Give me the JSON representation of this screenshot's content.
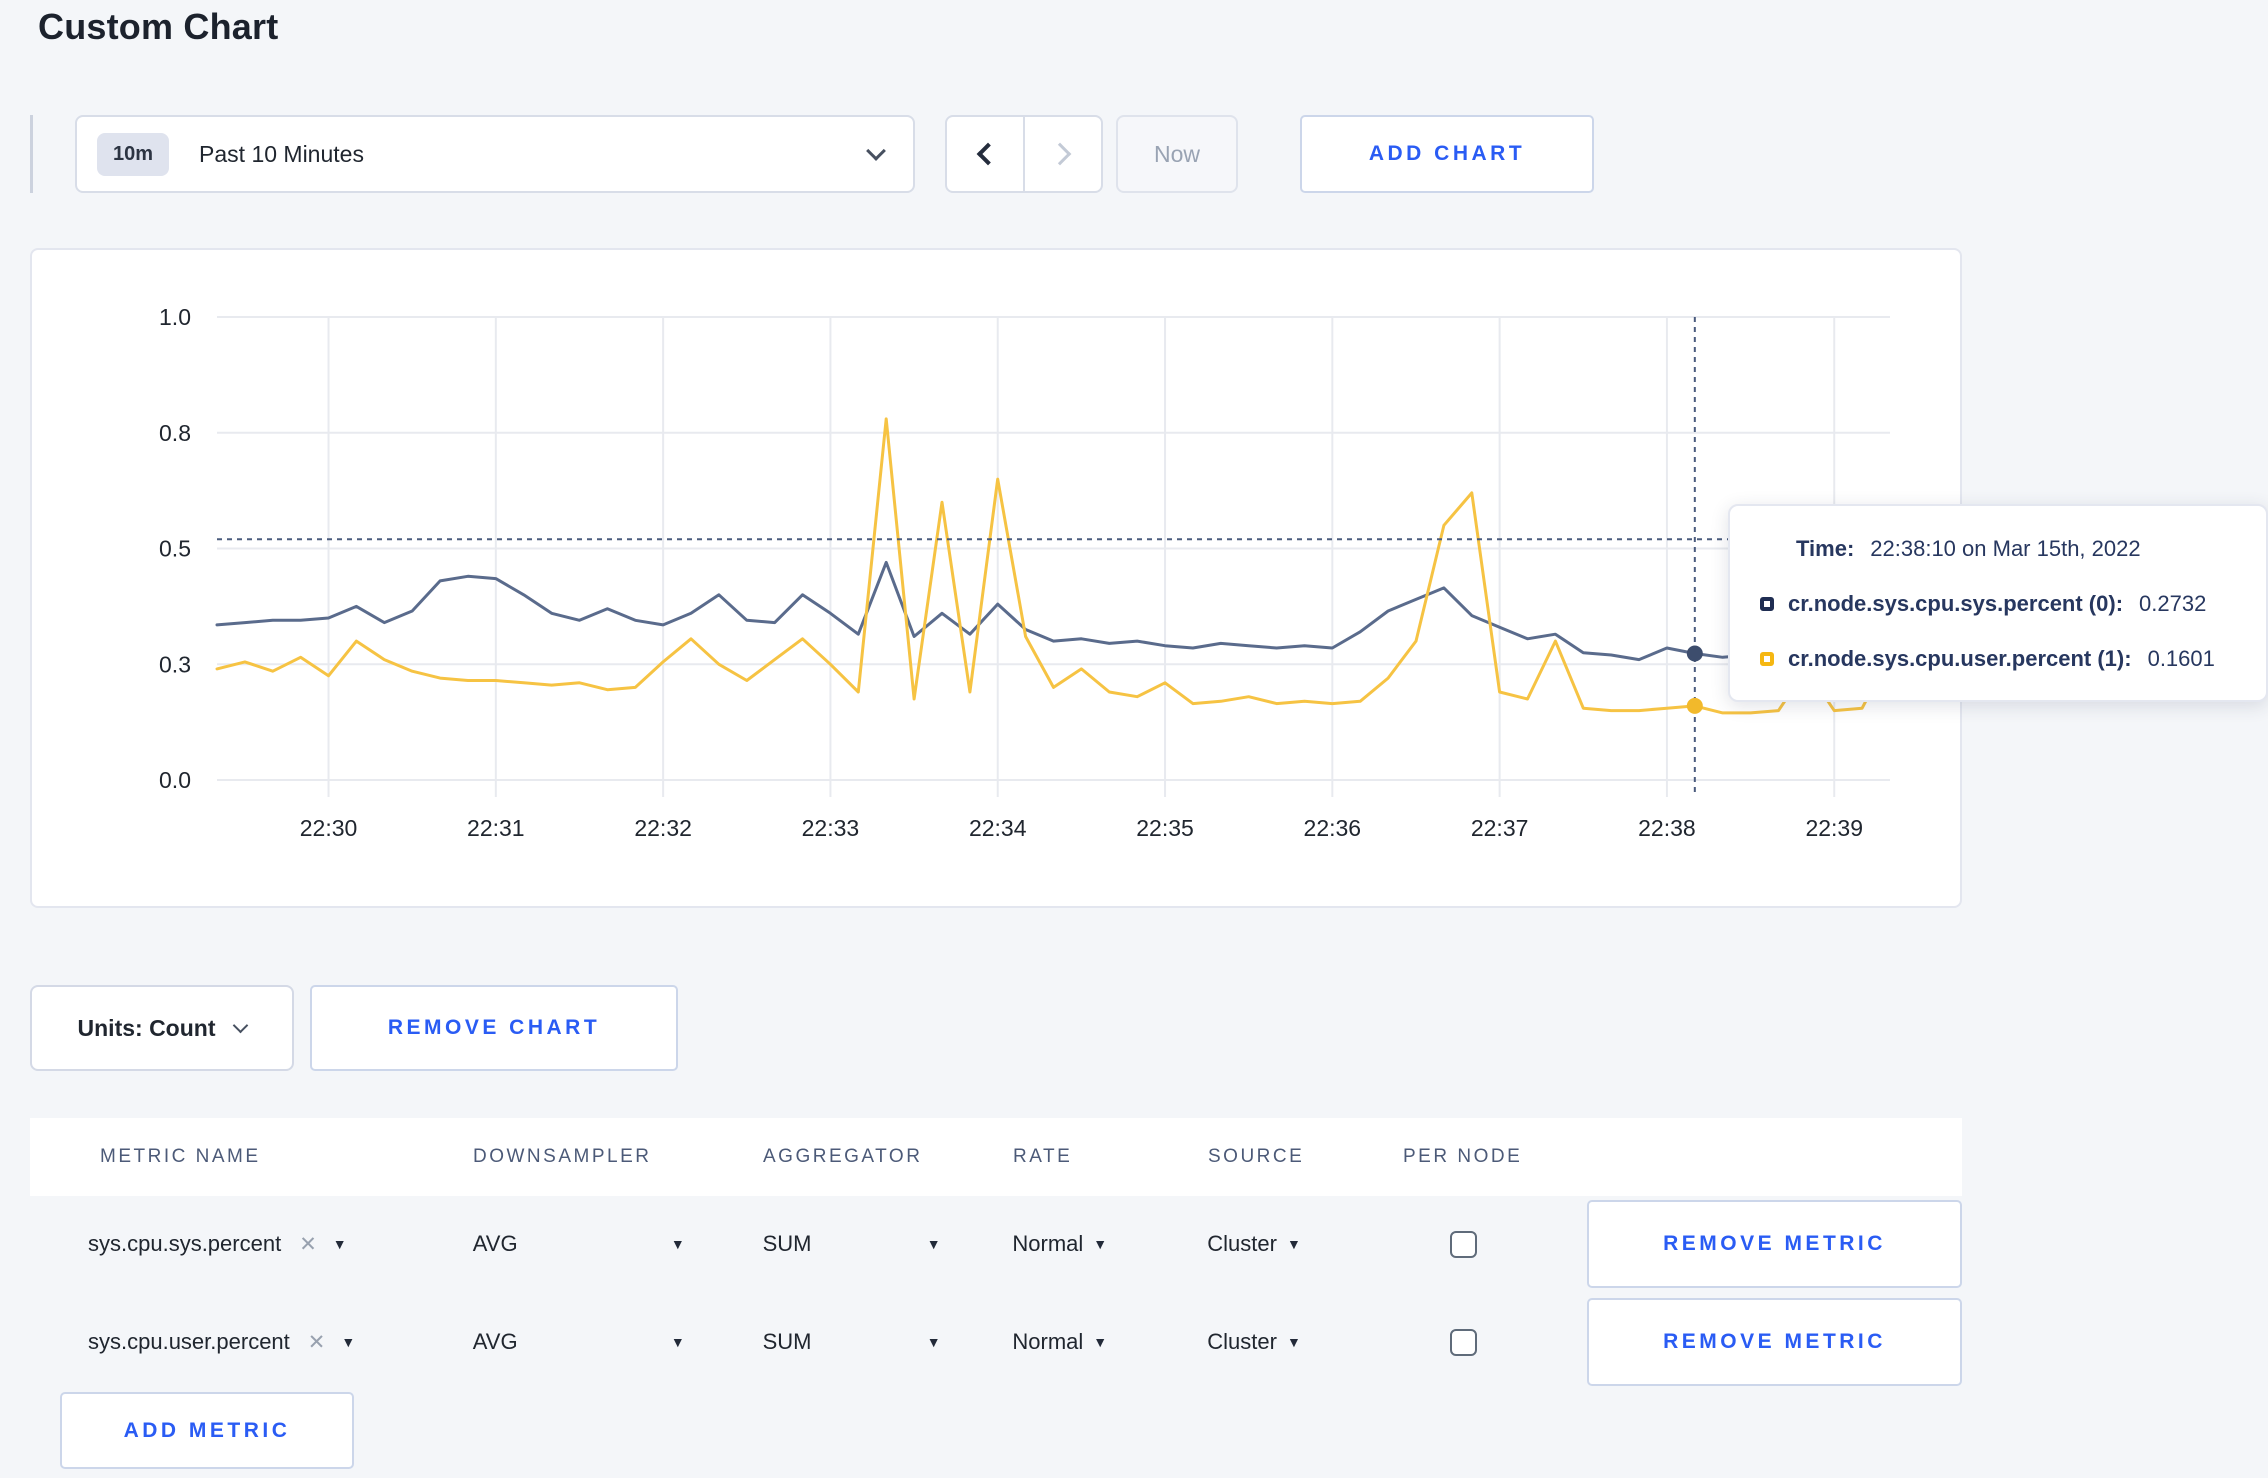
{
  "page": {
    "title": "Custom Chart"
  },
  "toolbar": {
    "time_badge": "10m",
    "time_label": "Past 10 Minutes",
    "now_label": "Now",
    "add_chart_label": "ADD CHART"
  },
  "chart": {
    "units_label": "Units: Count",
    "remove_chart_label": "REMOVE CHART"
  },
  "chart_data": {
    "type": "line",
    "title": "",
    "xlabel": "",
    "ylabel": "",
    "ylim": [
      0,
      1
    ],
    "grid": true,
    "x_start": "22:29:20",
    "x_step_seconds": 10,
    "x_ticks": [
      {
        "t": 40,
        "label": "22:30"
      },
      {
        "t": 100,
        "label": "22:31"
      },
      {
        "t": 160,
        "label": "22:32"
      },
      {
        "t": 220,
        "label": "22:33"
      },
      {
        "t": 280,
        "label": "22:34"
      },
      {
        "t": 340,
        "label": "22:35"
      },
      {
        "t": 400,
        "label": "22:36"
      },
      {
        "t": 460,
        "label": "22:37"
      },
      {
        "t": 520,
        "label": "22:38"
      },
      {
        "t": 580,
        "label": "22:39"
      }
    ],
    "y_ticks": [
      {
        "v": 1.0,
        "label": "1.0"
      },
      {
        "v": 0.75,
        "label": "0.8"
      },
      {
        "v": 0.5,
        "label": "0.5"
      },
      {
        "v": 0.25,
        "label": "0.3"
      },
      {
        "v": 0.0,
        "label": "0.0"
      }
    ],
    "series": [
      {
        "name": "cr.node.sys.cpu.sys.percent (0)",
        "color": "#5a6b8c",
        "marker_color": "#3d4d6d",
        "values": [
          0.335,
          0.34,
          0.345,
          0.345,
          0.35,
          0.375,
          0.34,
          0.365,
          0.43,
          0.44,
          0.435,
          0.4,
          0.36,
          0.345,
          0.37,
          0.345,
          0.335,
          0.36,
          0.4,
          0.345,
          0.34,
          0.4,
          0.36,
          0.315,
          0.47,
          0.31,
          0.36,
          0.315,
          0.38,
          0.325,
          0.3,
          0.305,
          0.295,
          0.3,
          0.29,
          0.285,
          0.295,
          0.29,
          0.285,
          0.29,
          0.285,
          0.32,
          0.365,
          0.39,
          0.415,
          0.355,
          0.33,
          0.305,
          0.315,
          0.275,
          0.27,
          0.26,
          0.285,
          0.2732,
          0.265,
          0.27,
          0.3,
          0.305,
          0.295,
          0.3,
          0.3
        ]
      },
      {
        "name": "cr.node.sys.cpu.user.percent (1)",
        "color": "#f6c343",
        "marker_color": "#f2b92b",
        "values": [
          0.24,
          0.255,
          0.235,
          0.265,
          0.225,
          0.3,
          0.26,
          0.235,
          0.22,
          0.215,
          0.215,
          0.21,
          0.205,
          0.21,
          0.195,
          0.2,
          0.255,
          0.305,
          0.25,
          0.215,
          0.26,
          0.305,
          0.25,
          0.19,
          0.78,
          0.175,
          0.6,
          0.19,
          0.65,
          0.31,
          0.2,
          0.24,
          0.19,
          0.18,
          0.21,
          0.165,
          0.17,
          0.18,
          0.165,
          0.17,
          0.165,
          0.17,
          0.22,
          0.3,
          0.55,
          0.62,
          0.19,
          0.175,
          0.3,
          0.155,
          0.15,
          0.15,
          0.155,
          0.1601,
          0.145,
          0.145,
          0.15,
          0.24,
          0.15,
          0.155,
          0.27
        ]
      }
    ],
    "crosshair": {
      "t": 530,
      "y": 0.52
    },
    "tooltip": {
      "time_label": "Time:",
      "time_value": "22:38:10 on Mar 15th, 2022",
      "rows": [
        {
          "name": "cr.node.sys.cpu.sys.percent (0):",
          "value": "0.2732",
          "swatch": "#1f2d52"
        },
        {
          "name": "cr.node.sys.cpu.user.percent (1):",
          "value": "0.1601",
          "swatch": "#f5b712"
        }
      ]
    }
  },
  "metrics_table": {
    "headers": [
      "METRIC NAME",
      "DOWNSAMPLER",
      "AGGREGATOR",
      "RATE",
      "SOURCE",
      "PER NODE"
    ],
    "rows": [
      {
        "metric": "sys.cpu.sys.percent",
        "downsampler": "AVG",
        "aggregator": "SUM",
        "rate": "Normal",
        "source": "Cluster",
        "per_node_checked": false,
        "remove_label": "REMOVE METRIC"
      },
      {
        "metric": "sys.cpu.user.percent",
        "downsampler": "AVG",
        "aggregator": "SUM",
        "rate": "Normal",
        "source": "Cluster",
        "per_node_checked": false,
        "remove_label": "REMOVE METRIC"
      }
    ],
    "add_metric_label": "ADD METRIC"
  }
}
